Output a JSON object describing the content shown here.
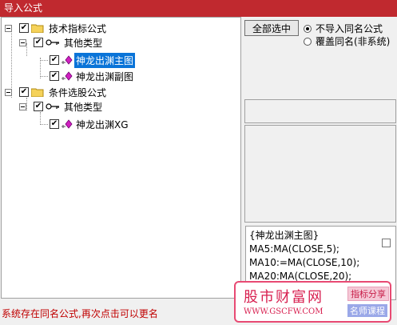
{
  "window": {
    "title": "导入公式"
  },
  "tree": {
    "root1": {
      "label": "技术指标公式",
      "checked": true
    },
    "root1_child": {
      "label": "其他类型",
      "checked": true
    },
    "root1_leaf1": {
      "label": "神龙出渊主图",
      "checked": true,
      "selected": true
    },
    "root1_leaf2": {
      "label": "神龙出渊副图",
      "checked": true
    },
    "root2": {
      "label": "条件选股公式",
      "checked": true
    },
    "root2_child": {
      "label": "其他类型",
      "checked": true
    },
    "root2_leaf1": {
      "label": "神龙出渊XG",
      "checked": true
    }
  },
  "controls": {
    "select_all_label": "全部选中",
    "radio_skip_label": "不导入同名公式",
    "radio_overwrite_label": "覆盖同名(非系统)",
    "selected_option": "不导入同名公式"
  },
  "formula": {
    "lines": [
      "{神龙出渊主图}",
      "MA5:MA(CLOSE,5);",
      "MA10:=MA(CLOSE,10);",
      "MA20:MA(CLOSE,20);"
    ]
  },
  "status_text": "系统存在同名公式,再次点击可以更名",
  "watermark": {
    "name": "股市财富网",
    "url": "WWW.GSCFW.COM",
    "tag1": "指标分享",
    "tag2": "名师课程"
  },
  "colors": {
    "titlebar": "#c0292f",
    "selection": "#0a74d8",
    "status": "#c00000"
  }
}
